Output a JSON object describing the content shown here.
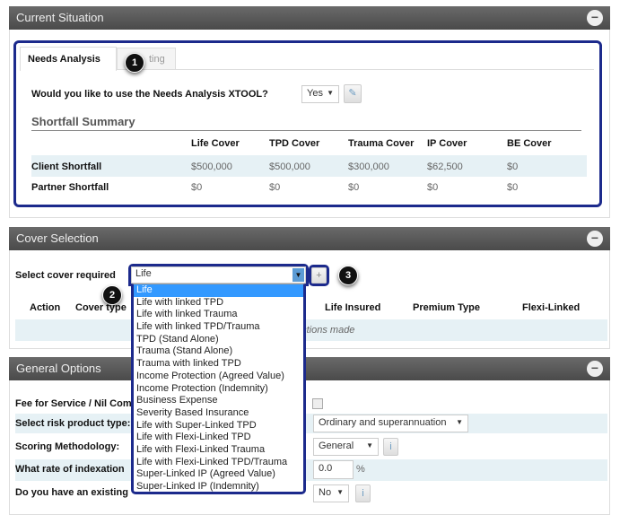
{
  "current_situation": {
    "title": "Current Situation",
    "tabs": [
      {
        "label": "Needs Analysis"
      },
      {
        "label": "ting"
      }
    ],
    "question": "Would you like to use the Needs Analysis XTOOL?",
    "question_value": "Yes",
    "shortfall_title": "Shortfall Summary",
    "columns": [
      "Life Cover",
      "TPD Cover",
      "Trauma Cover",
      "IP Cover",
      "BE Cover"
    ],
    "rows": [
      {
        "label": "Client Shortfall",
        "values": [
          "$500,000",
          "$500,000",
          "$300,000",
          "$62,500",
          "$0"
        ]
      },
      {
        "label": "Partner Shortfall",
        "values": [
          "$0",
          "$0",
          "$0",
          "$0",
          "$0"
        ]
      }
    ]
  },
  "cover_selection": {
    "title": "Cover Selection",
    "select_label": "Select cover required",
    "select_value": "Life",
    "add_label": "+",
    "columns": [
      "Action",
      "Cover type",
      "Life Insured",
      "Premium Type",
      "Flexi-Linked"
    ],
    "empty_text": "ections made",
    "options": [
      "Life",
      "Life with linked TPD",
      "Life with linked Trauma",
      "Life with linked TPD/Trauma",
      "TPD (Stand Alone)",
      "Trauma (Stand Alone)",
      "Trauma with linked TPD",
      "Income Protection (Agreed Value)",
      "Income Protection (Indemnity)",
      "Business Expense",
      "Severity Based Insurance",
      "Life with Super-Linked TPD",
      "Life with Flexi-Linked TPD",
      "Life with Flexi-Linked Trauma",
      "Life with Flexi-Linked TPD/Trauma",
      "Super-Linked IP (Agreed Value)",
      "Super-Linked IP (Indemnity)"
    ]
  },
  "general_options": {
    "title": "General Options",
    "fee_label": "Fee for Service / Nil Com",
    "risk_label": "Select risk product type:",
    "risk_value": "Ordinary and superannuation",
    "scoring_label": "Scoring Methodology:",
    "scoring_value": "General",
    "info": "i",
    "indexation_label": "What rate of indexation",
    "indexation_value": "0.0",
    "percent": "%",
    "existing_label": "Do you have an existing",
    "existing_value": "No"
  },
  "badges": [
    "1",
    "2",
    "3"
  ],
  "colors": {
    "highlight": "#1c2a8c",
    "header": "#555555",
    "row": "#e6f1f5",
    "selected": "#3399ff"
  }
}
